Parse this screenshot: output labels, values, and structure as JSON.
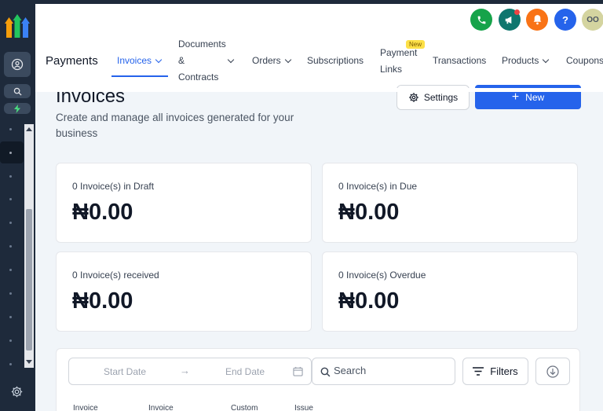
{
  "sidebar": {
    "icons": [
      "user-icon",
      "search-icon",
      "bolt-icon",
      "gear-icon"
    ]
  },
  "header": {
    "icons": [
      {
        "name": "phone-icon",
        "color": "#16a34a"
      },
      {
        "name": "megaphone-icon",
        "color": "#0f766e"
      },
      {
        "name": "bell-icon",
        "color": "#f97316"
      },
      {
        "name": "help-icon",
        "color": "#2563eb",
        "glyph": "?"
      },
      {
        "name": "avatar",
        "color": "#d4d4a0",
        "initials": "OO"
      }
    ],
    "title": "Payments",
    "nav": {
      "invoices": "Invoices",
      "documents_line1": "Documents",
      "documents_line2": "&",
      "documents_line3": "Contracts",
      "orders": "Orders",
      "subscriptions": "Subscriptions",
      "payment_links_line1": "Payment",
      "payment_links_line2": "Links",
      "payment_links_badge": "New",
      "transactions": "Transactions",
      "products": "Products",
      "coupons": "Coupons"
    }
  },
  "main": {
    "title": "Invoices",
    "subtitle": "Create and manage all invoices generated for your business",
    "settings_label": "Settings",
    "new_label": "New",
    "accent_color": "#2563eb",
    "cards": [
      {
        "label": "0 Invoice(s) in Draft",
        "value": "₦0.00"
      },
      {
        "label": "0 Invoice(s) in Due",
        "value": "₦0.00"
      },
      {
        "label": "0 Invoice(s) received",
        "value": "₦0.00"
      },
      {
        "label": "0 Invoice(s) Overdue",
        "value": "₦0.00"
      }
    ],
    "table": {
      "start_date_placeholder": "Start Date",
      "end_date_placeholder": "End Date",
      "search_placeholder": "Search",
      "filters_label": "Filters",
      "columns": [
        "Invoice",
        "Invoice",
        "Custom",
        "Issue"
      ]
    }
  }
}
